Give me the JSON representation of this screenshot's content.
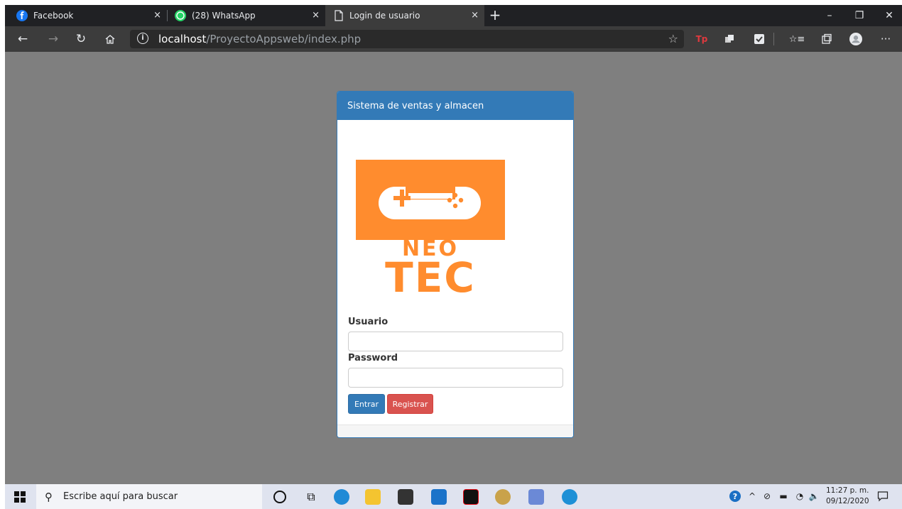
{
  "tabs": [
    {
      "label": "Facebook",
      "icon": "facebook-icon",
      "close": "×"
    },
    {
      "label": "(28) WhatsApp",
      "icon": "whatsapp-icon",
      "close": "×"
    },
    {
      "label": "Login de usuario",
      "icon": "page-icon",
      "close": "×"
    }
  ],
  "newtab": "+",
  "window_controls": {
    "minimize": "–",
    "restore": "❐",
    "close": "✕"
  },
  "address": {
    "host": "localhost",
    "path": "/ProyectoAppsweb/index.php"
  },
  "login": {
    "heading": "Sistema de ventas y almacen",
    "logo_text_top": "NEO",
    "logo_text_bottom": "TEC",
    "user_label": "Usuario",
    "user_value": "",
    "password_label": "Password",
    "password_value": "",
    "submit_label": "Entrar",
    "register_label": "Registrar"
  },
  "taskbar": {
    "search_placeholder": "Escribe aquí para buscar",
    "time": "11:27 p. m.",
    "date": "09/12/2020"
  },
  "colors": {
    "primary": "#337ab7",
    "danger": "#d9534f",
    "logo_orange": "#ff8c2e",
    "backdrop": "#7f7f7f"
  }
}
